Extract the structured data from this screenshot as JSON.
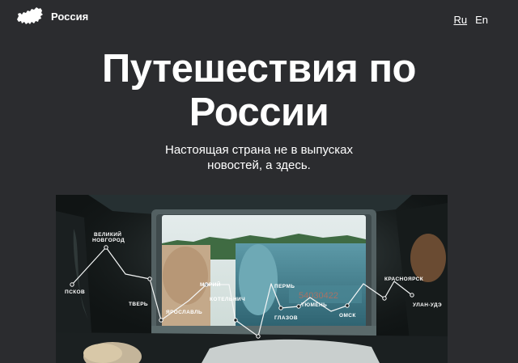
{
  "header": {
    "logo_text": "Россия",
    "logo_icon": "russia-map-icon",
    "lang": [
      {
        "label": "Ru",
        "active": true
      },
      {
        "label": "En",
        "active": false
      }
    ]
  },
  "hero": {
    "title_line1": "Путешествия по",
    "title_line2": "России",
    "subtitle_line1": "Настоящая страна не в выпусках",
    "subtitle_line2": "новостей, а здесь.",
    "route": {
      "cities": [
        {
          "name": "ПСКОВ"
        },
        {
          "name_line1": "ВЕЛИКИЙ",
          "name_line2": "НОВГОРОД"
        },
        {
          "name": "ТВЕРЬ"
        },
        {
          "name": "ЯРОСЛАВЛЬ"
        },
        {
          "name": "МАРИЙ"
        },
        {
          "name": "КОТЕЛЬНИЧ"
        },
        {
          "name": "ГЛАЗОВ"
        },
        {
          "name": "ПЕРМЬ"
        },
        {
          "name": "ТЮМЕНЬ"
        },
        {
          "name": "ОМСК"
        },
        {
          "name": "КРАСНОЯРСК"
        },
        {
          "name": "УЛАН-УДЭ"
        }
      ]
    }
  }
}
